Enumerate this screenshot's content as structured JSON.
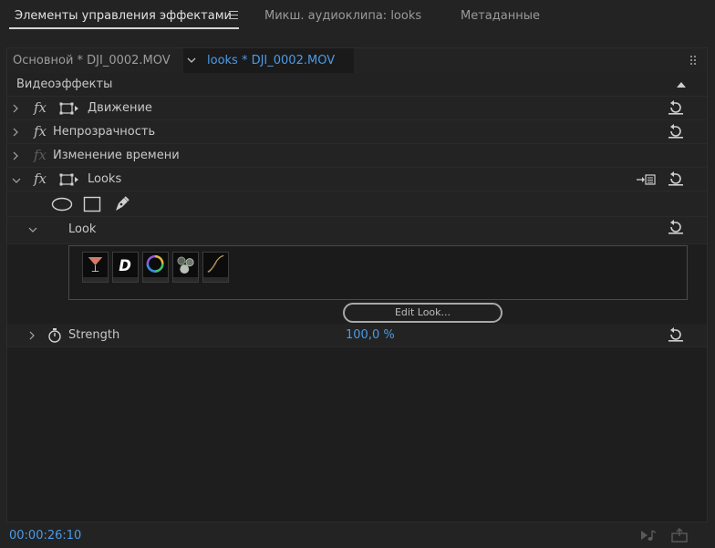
{
  "tabs": [
    {
      "label": "Элементы управления эффектами"
    },
    {
      "label": "Микш. аудиоклипа: looks"
    },
    {
      "label": "Метаданные"
    }
  ],
  "clip_tabs": {
    "main": "Основной * DJI_0002.MOV",
    "selected": "looks * DJI_0002.MOV"
  },
  "section_title": "Видеоэффекты",
  "effects": [
    {
      "label": "Движение",
      "fx_enabled": true
    },
    {
      "label": "Непрозрачность",
      "fx_enabled": true
    },
    {
      "label": "Изменение времени",
      "fx_enabled": false
    },
    {
      "label": "Looks",
      "fx_enabled": true
    }
  ],
  "look": {
    "label": "Look",
    "edit_button": "Edit Look...",
    "thumbnails": [
      {
        "icon": "cocktail-glass-icon",
        "color": "#d57b6b"
      },
      {
        "icon": "letter-d-icon",
        "color": "#ffffff"
      },
      {
        "icon": "color-wheel-icon",
        "color": "#8f5bd8"
      },
      {
        "icon": "circles-icon",
        "color": "#9aa69a"
      },
      {
        "icon": "curve-icon",
        "color": "#c9a46a"
      }
    ]
  },
  "strength": {
    "label": "Strength",
    "value": "100,0 %"
  },
  "timecode": "00:00:26:10",
  "accent_color": "#4a9be8"
}
